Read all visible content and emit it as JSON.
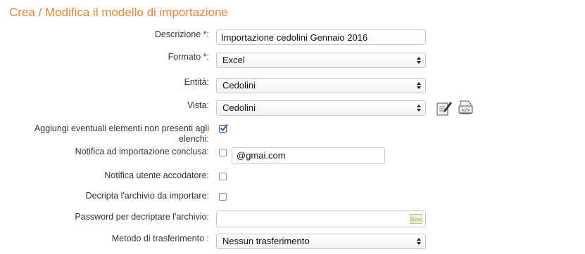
{
  "page": {
    "title": "Crea / Modifica il modello di importazione"
  },
  "form": {
    "descrizione": {
      "label": "Descrizione *:",
      "value": "Importazione cedolini Gennaio 2016"
    },
    "formato": {
      "label": "Formato *:",
      "selected": "Excel"
    },
    "entita": {
      "label": "Entità:",
      "selected": "Cedolini"
    },
    "vista": {
      "label": "Vista:",
      "selected": "Cedolini",
      "icons": [
        "edit-view-icon",
        "xml-view-icon"
      ]
    },
    "aggiungi": {
      "label": "Aggiungi eventuali elementi non presenti agli elenchi:",
      "checked": true
    },
    "notifica_importazione": {
      "label": "Notifica ad importazione conclusa:",
      "checked": false,
      "email": "@gmai.com"
    },
    "notifica_utente": {
      "label": "Notifica utente accodatore:",
      "checked": false
    },
    "decripta": {
      "label": "Decripta l'archivio da importare:",
      "checked": false
    },
    "password": {
      "label": "Password per decriptare l'archivio:",
      "value": "",
      "icon": "password-box-icon"
    },
    "metodo": {
      "label": "Metodo di trasferimento :",
      "selected": "Nessun trasferimento"
    }
  },
  "colors": {
    "title": "#ee8433",
    "checkbox_checked": "#2f5ea8"
  }
}
